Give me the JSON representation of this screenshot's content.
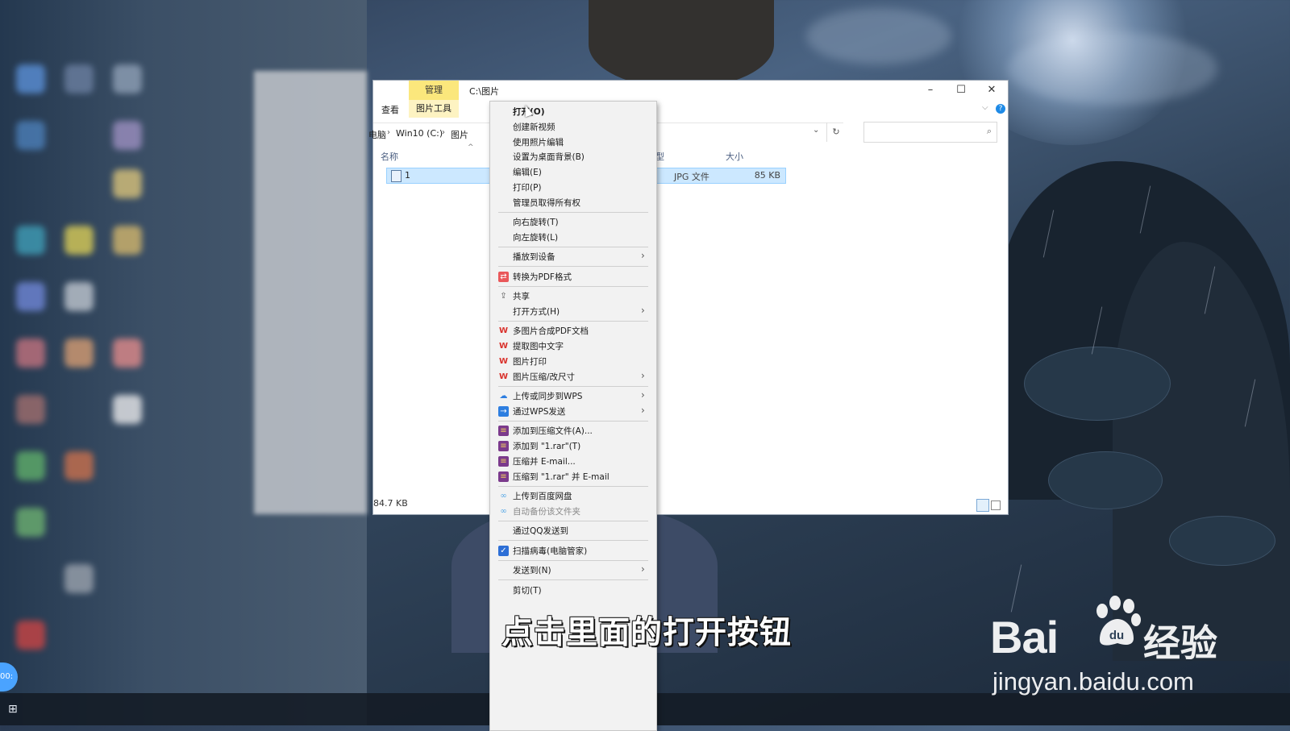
{
  "explorer": {
    "ribbon_context_tab": "管理",
    "title_path": "C:\\图片",
    "tab_view": "查看",
    "tab_picture_tools": "图片工具",
    "window_buttons": {
      "minimize": "–",
      "maximize": "☐",
      "close": "✕"
    },
    "breadcrumb": [
      "电脑",
      "Win10 (C:)",
      "图片"
    ],
    "columns": {
      "name": "名称",
      "type": "类型",
      "size": "大小"
    },
    "file": {
      "name": "1",
      "type": "JPG 文件",
      "size": "85 KB"
    },
    "status_size": "84.7 KB"
  },
  "context_menu": {
    "items": [
      {
        "label": "打开(O)",
        "bold": true
      },
      {
        "label": "创建新视频"
      },
      {
        "label": "使用照片编辑"
      },
      {
        "label": "设置为桌面背景(B)"
      },
      {
        "label": "编辑(E)"
      },
      {
        "label": "打印(P)"
      },
      {
        "label": "管理员取得所有权"
      },
      {
        "label": "向右旋转(T)"
      },
      {
        "label": "向左旋转(L)"
      },
      {
        "label": "播放到设备",
        "submenu": true
      },
      {
        "label": "转换为PDF格式",
        "icon": "pdf-convert-icon"
      },
      {
        "label": "共享",
        "icon": "share-icon"
      },
      {
        "label": "打开方式(H)",
        "submenu": true
      },
      {
        "label": "多图片合成PDF文档",
        "icon": "wps-icon"
      },
      {
        "label": "提取图中文字",
        "icon": "wps-icon"
      },
      {
        "label": "图片打印",
        "icon": "wps-icon"
      },
      {
        "label": "图片压缩/改尺寸",
        "icon": "wps-icon",
        "submenu": true
      },
      {
        "label": "上传或同步到WPS",
        "icon": "cloud-upload-icon",
        "submenu": true
      },
      {
        "label": "通过WPS发送",
        "icon": "wps-send-icon",
        "submenu": true
      },
      {
        "label": "添加到压缩文件(A)...",
        "icon": "winrar-icon"
      },
      {
        "label": "添加到 \"1.rar\"(T)",
        "icon": "winrar-icon"
      },
      {
        "label": "压缩并 E-mail...",
        "icon": "winrar-icon"
      },
      {
        "label": "压缩到 \"1.rar\" 并 E-mail",
        "icon": "winrar-icon"
      },
      {
        "label": "上传到百度网盘",
        "icon": "baidu-netdisk-icon"
      },
      {
        "label": "自动备份该文件夹",
        "icon": "baidu-netdisk-icon",
        "disabled": true
      },
      {
        "label": "通过QQ发送到"
      },
      {
        "label": "扫描病毒(电脑管家)",
        "icon": "shield-icon"
      },
      {
        "label": "发送到(N)",
        "submenu": true
      },
      {
        "label": "剪切(T)"
      }
    ]
  },
  "caption": "点击里面的打开按钮",
  "watermark": {
    "logo_text": "Bai",
    "logo_suffix": "经验",
    "url": "jingyan.baidu.com"
  },
  "taskbar": {
    "clock_badge": "00:"
  },
  "colors": {
    "ribbon_manage": "#fbe77c",
    "selection": "#cce8ff",
    "wps_red": "#d9312b",
    "winrar": "#7b3a8c",
    "accent_blue": "#1e8ae6"
  }
}
